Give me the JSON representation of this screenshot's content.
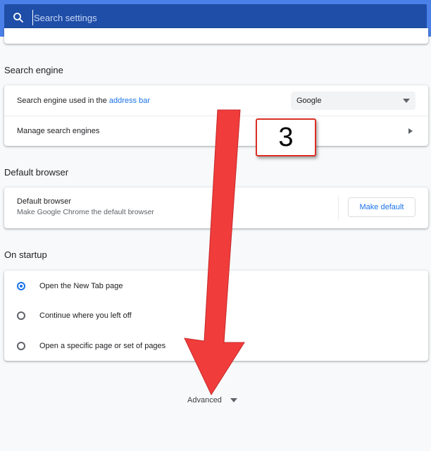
{
  "search": {
    "placeholder": "Search settings"
  },
  "sections": {
    "search_engine": {
      "title": "Search engine",
      "row1_label_prefix": "Search engine used in the",
      "row1_link": "address bar",
      "dropdown_value": "Google",
      "row2_label": "Manage search engines"
    },
    "default_browser": {
      "title": "Default browser",
      "label": "Default browser",
      "sublabel": "Make Google Chrome the default browser",
      "button": "Make default"
    },
    "on_startup": {
      "title": "On startup",
      "options": [
        {
          "label": "Open the New Tab page",
          "selected": true
        },
        {
          "label": "Continue where you left off",
          "selected": false
        },
        {
          "label": "Open a specific page or set of pages",
          "selected": false
        }
      ]
    }
  },
  "advanced": {
    "label": "Advanced"
  },
  "annotation": {
    "text": "3",
    "arrow_color": "#f13c3c"
  },
  "colors": {
    "header": "#4a80e8",
    "search_bar": "#1f4ea8",
    "accent": "#1a73e8"
  },
  "icons": [
    "search-icon",
    "caret-down-icon",
    "chevron-right-icon"
  ]
}
